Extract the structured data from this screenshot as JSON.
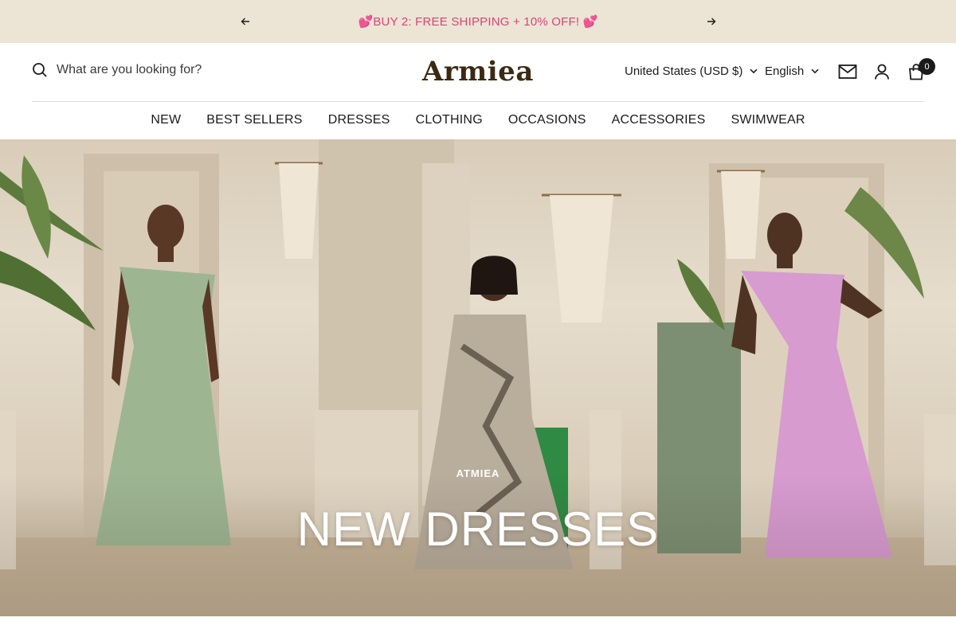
{
  "announcement": {
    "message": "💕BUY 2: FREE SHIPPING + 10% OFF! 💕",
    "prev_icon": "arrow-left-icon",
    "next_icon": "arrow-right-icon"
  },
  "header": {
    "search_placeholder": "What are you looking for?",
    "logo": "Armiea",
    "currency": "United States (USD $)",
    "language": "English",
    "cart_count": "0",
    "icons": [
      "search-icon",
      "mail-icon",
      "account-icon",
      "cart-icon"
    ]
  },
  "nav": {
    "items": [
      "NEW",
      "BEST SELLERS",
      "DRESSES",
      "CLOTHING",
      "OCCASIONS",
      "ACCESSORIES",
      "SWIMWEAR"
    ]
  },
  "hero": {
    "eyebrow": "ATMIEA",
    "headline": "NEW DRESSES"
  },
  "colors": {
    "announcement_bg": "#ece4d4",
    "announcement_text": "#d8457a",
    "logo": "#3b2a13",
    "text": "#1c1b1b"
  }
}
